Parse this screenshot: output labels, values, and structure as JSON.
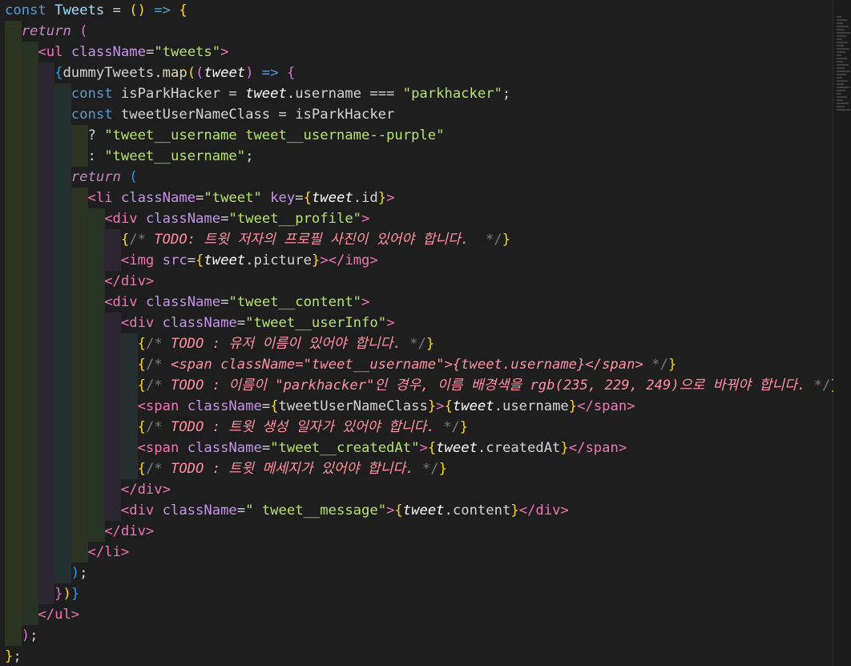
{
  "editor": {
    "language": "javascript-react",
    "lines": [
      {
        "indent": 0,
        "tokens": [
          [
            "kw",
            "const "
          ],
          [
            "var",
            "Tweets"
          ],
          [
            "op",
            " = "
          ],
          [
            "br1",
            "()"
          ],
          [
            "op",
            " "
          ],
          [
            "kw",
            "=>"
          ],
          [
            "op",
            " "
          ],
          [
            "br1",
            "{"
          ]
        ]
      },
      {
        "indent": 1,
        "tokens": [
          [
            "kwi",
            "return"
          ],
          [
            "op",
            " "
          ],
          [
            "br2",
            "("
          ]
        ]
      },
      {
        "indent": 2,
        "tokens": [
          [
            "tag",
            "<ul"
          ],
          [
            "op",
            " "
          ],
          [
            "attr",
            "className"
          ],
          [
            "op",
            "="
          ],
          [
            "strg",
            "\"tweets\""
          ],
          [
            "tag",
            ">"
          ]
        ]
      },
      {
        "indent": 3,
        "tokens": [
          [
            "br3",
            "{"
          ],
          [
            "punc",
            "dummyTweets."
          ],
          [
            "fn",
            "map"
          ],
          [
            "br1",
            "("
          ],
          [
            "br2",
            "("
          ],
          [
            "it",
            "tweet"
          ],
          [
            "br2",
            ")"
          ],
          [
            "op",
            " "
          ],
          [
            "kw",
            "=>"
          ],
          [
            "op",
            " "
          ],
          [
            "br2",
            "{"
          ]
        ]
      },
      {
        "indent": 4,
        "tokens": [
          [
            "kw",
            "const "
          ],
          [
            "punc",
            "isParkHacker = "
          ],
          [
            "it",
            "tweet"
          ],
          [
            "punc",
            ".username === "
          ],
          [
            "strg",
            "\"parkhacker\""
          ],
          [
            "punc",
            ";"
          ]
        ]
      },
      {
        "indent": 4,
        "tokens": [
          [
            "kw",
            "const "
          ],
          [
            "punc",
            "tweetUserNameClass = isParkHacker"
          ]
        ]
      },
      {
        "indent": 5,
        "tokens": [
          [
            "punc",
            "? "
          ],
          [
            "strg",
            "\"tweet__username tweet__username--purple\""
          ]
        ]
      },
      {
        "indent": 5,
        "tokens": [
          [
            "punc",
            ": "
          ],
          [
            "strg",
            "\"tweet__username\""
          ],
          [
            "punc",
            ";"
          ]
        ]
      },
      {
        "indent": 4,
        "tokens": [
          [
            "kwi",
            "return"
          ],
          [
            "op",
            " "
          ],
          [
            "br3",
            "("
          ]
        ]
      },
      {
        "indent": 5,
        "tokens": [
          [
            "tag",
            "<li"
          ],
          [
            "op",
            " "
          ],
          [
            "attr",
            "className"
          ],
          [
            "op",
            "="
          ],
          [
            "strg",
            "\"tweet\""
          ],
          [
            "op",
            " "
          ],
          [
            "attr",
            "key"
          ],
          [
            "op",
            "="
          ],
          [
            "br1",
            "{"
          ],
          [
            "it",
            "tweet"
          ],
          [
            "punc",
            ".id"
          ],
          [
            "br1",
            "}"
          ],
          [
            "tag",
            ">"
          ]
        ]
      },
      {
        "indent": 6,
        "tokens": [
          [
            "tag",
            "<div"
          ],
          [
            "op",
            " "
          ],
          [
            "attr",
            "className"
          ],
          [
            "op",
            "="
          ],
          [
            "strg",
            "\"tweet__profile\""
          ],
          [
            "tag",
            ">"
          ]
        ]
      },
      {
        "indent": 7,
        "tokens": [
          [
            "br1",
            "{"
          ],
          [
            "cmtd",
            "/* "
          ],
          [
            "cmt",
            "TODO: 트윗 저자의 프로필 사진이 있어야 합니다.  "
          ],
          [
            "cmtd",
            "*/"
          ],
          [
            "br1",
            "}"
          ]
        ]
      },
      {
        "indent": 7,
        "tokens": [
          [
            "tag",
            "<img"
          ],
          [
            "op",
            " "
          ],
          [
            "attr",
            "src"
          ],
          [
            "op",
            "="
          ],
          [
            "br1",
            "{"
          ],
          [
            "it",
            "tweet"
          ],
          [
            "punc",
            ".picture"
          ],
          [
            "br1",
            "}"
          ],
          [
            "tag",
            "></img>"
          ]
        ]
      },
      {
        "indent": 6,
        "tokens": [
          [
            "tag",
            "</div>"
          ]
        ]
      },
      {
        "indent": 6,
        "tokens": [
          [
            "tag",
            "<div"
          ],
          [
            "op",
            " "
          ],
          [
            "attr",
            "className"
          ],
          [
            "op",
            "="
          ],
          [
            "strg",
            "\"tweet__content\""
          ],
          [
            "tag",
            ">"
          ]
        ]
      },
      {
        "indent": 7,
        "tokens": [
          [
            "tag",
            "<div"
          ],
          [
            "op",
            " "
          ],
          [
            "attr",
            "className"
          ],
          [
            "op",
            "="
          ],
          [
            "strg",
            "\"tweet__userInfo\""
          ],
          [
            "tag",
            ">"
          ]
        ]
      },
      {
        "indent": 8,
        "tokens": [
          [
            "br1",
            "{"
          ],
          [
            "cmtd",
            "/* "
          ],
          [
            "cmt",
            "TODO : 유저 이름이 있어야 합니다. "
          ],
          [
            "cmtd",
            "*/"
          ],
          [
            "br1",
            "}"
          ]
        ]
      },
      {
        "indent": 8,
        "tokens": [
          [
            "br1",
            "{"
          ],
          [
            "cmtd",
            "/* "
          ],
          [
            "cmt",
            "<span className=\"tweet__username\">{tweet.username}</span> "
          ],
          [
            "cmtd",
            "*/"
          ],
          [
            "br1",
            "}"
          ]
        ]
      },
      {
        "indent": 8,
        "tokens": [
          [
            "br1",
            "{"
          ],
          [
            "cmtd",
            "/* "
          ],
          [
            "cmt",
            "TODO : 이름이 \"parkhacker\"인 경우, 이름 배경색을 rgb(235, 229, 249)으로 바꿔야 합니다. "
          ],
          [
            "cmtd",
            "*/"
          ],
          [
            "br1",
            "}"
          ]
        ]
      },
      {
        "indent": 8,
        "tokens": [
          [
            "tag",
            "<span"
          ],
          [
            "op",
            " "
          ],
          [
            "attr",
            "className"
          ],
          [
            "op",
            "="
          ],
          [
            "br1",
            "{"
          ],
          [
            "punc",
            "tweetUserNameClass"
          ],
          [
            "br1",
            "}"
          ],
          [
            "tag",
            ">"
          ],
          [
            "br1",
            "{"
          ],
          [
            "it",
            "tweet"
          ],
          [
            "punc",
            ".username"
          ],
          [
            "br1",
            "}"
          ],
          [
            "tag",
            "</span>"
          ]
        ]
      },
      {
        "indent": 8,
        "tokens": [
          [
            "br1",
            "{"
          ],
          [
            "cmtd",
            "/* "
          ],
          [
            "cmt",
            "TODO : 트윗 생성 일자가 있어야 합니다. "
          ],
          [
            "cmtd",
            "*/"
          ],
          [
            "br1",
            "}"
          ]
        ]
      },
      {
        "indent": 8,
        "tokens": [
          [
            "tag",
            "<span"
          ],
          [
            "op",
            " "
          ],
          [
            "attr",
            "className"
          ],
          [
            "op",
            "="
          ],
          [
            "strg",
            "\"tweet__createdAt\""
          ],
          [
            "tag",
            ">"
          ],
          [
            "br1",
            "{"
          ],
          [
            "it",
            "tweet"
          ],
          [
            "punc",
            ".createdAt"
          ],
          [
            "br1",
            "}"
          ],
          [
            "tag",
            "</span>"
          ]
        ]
      },
      {
        "indent": 8,
        "tokens": [
          [
            "br1",
            "{"
          ],
          [
            "cmtd",
            "/* "
          ],
          [
            "cmt",
            "TODO : 트윗 메세지가 있어야 합니다. "
          ],
          [
            "cmtd",
            "*/"
          ],
          [
            "br1",
            "}"
          ]
        ]
      },
      {
        "indent": 7,
        "tokens": [
          [
            "tag",
            "</div>"
          ]
        ]
      },
      {
        "indent": 7,
        "tokens": [
          [
            "tag",
            "<div"
          ],
          [
            "op",
            " "
          ],
          [
            "attr",
            "className"
          ],
          [
            "op",
            "="
          ],
          [
            "strg",
            "\" tweet__message\""
          ],
          [
            "tag",
            ">"
          ],
          [
            "br1",
            "{"
          ],
          [
            "it",
            "tweet"
          ],
          [
            "punc",
            ".content"
          ],
          [
            "br1",
            "}"
          ],
          [
            "tag",
            "</div>"
          ]
        ]
      },
      {
        "indent": 6,
        "tokens": [
          [
            "tag",
            "</div>"
          ]
        ]
      },
      {
        "indent": 5,
        "tokens": [
          [
            "tag",
            "</li>"
          ]
        ]
      },
      {
        "indent": 4,
        "tokens": [
          [
            "br3",
            ")"
          ],
          [
            "punc",
            ";"
          ]
        ]
      },
      {
        "indent": 3,
        "tokens": [
          [
            "br2",
            "}"
          ],
          [
            "br1",
            ")"
          ],
          [
            "br3",
            "}"
          ]
        ]
      },
      {
        "indent": 2,
        "tokens": [
          [
            "tag",
            "</ul>"
          ]
        ]
      },
      {
        "indent": 1,
        "tokens": [
          [
            "br2",
            ")"
          ],
          [
            "punc",
            ";"
          ]
        ]
      },
      {
        "indent": 0,
        "tokens": [
          [
            "br1",
            "}"
          ],
          [
            "punc",
            ";"
          ]
        ]
      }
    ]
  }
}
